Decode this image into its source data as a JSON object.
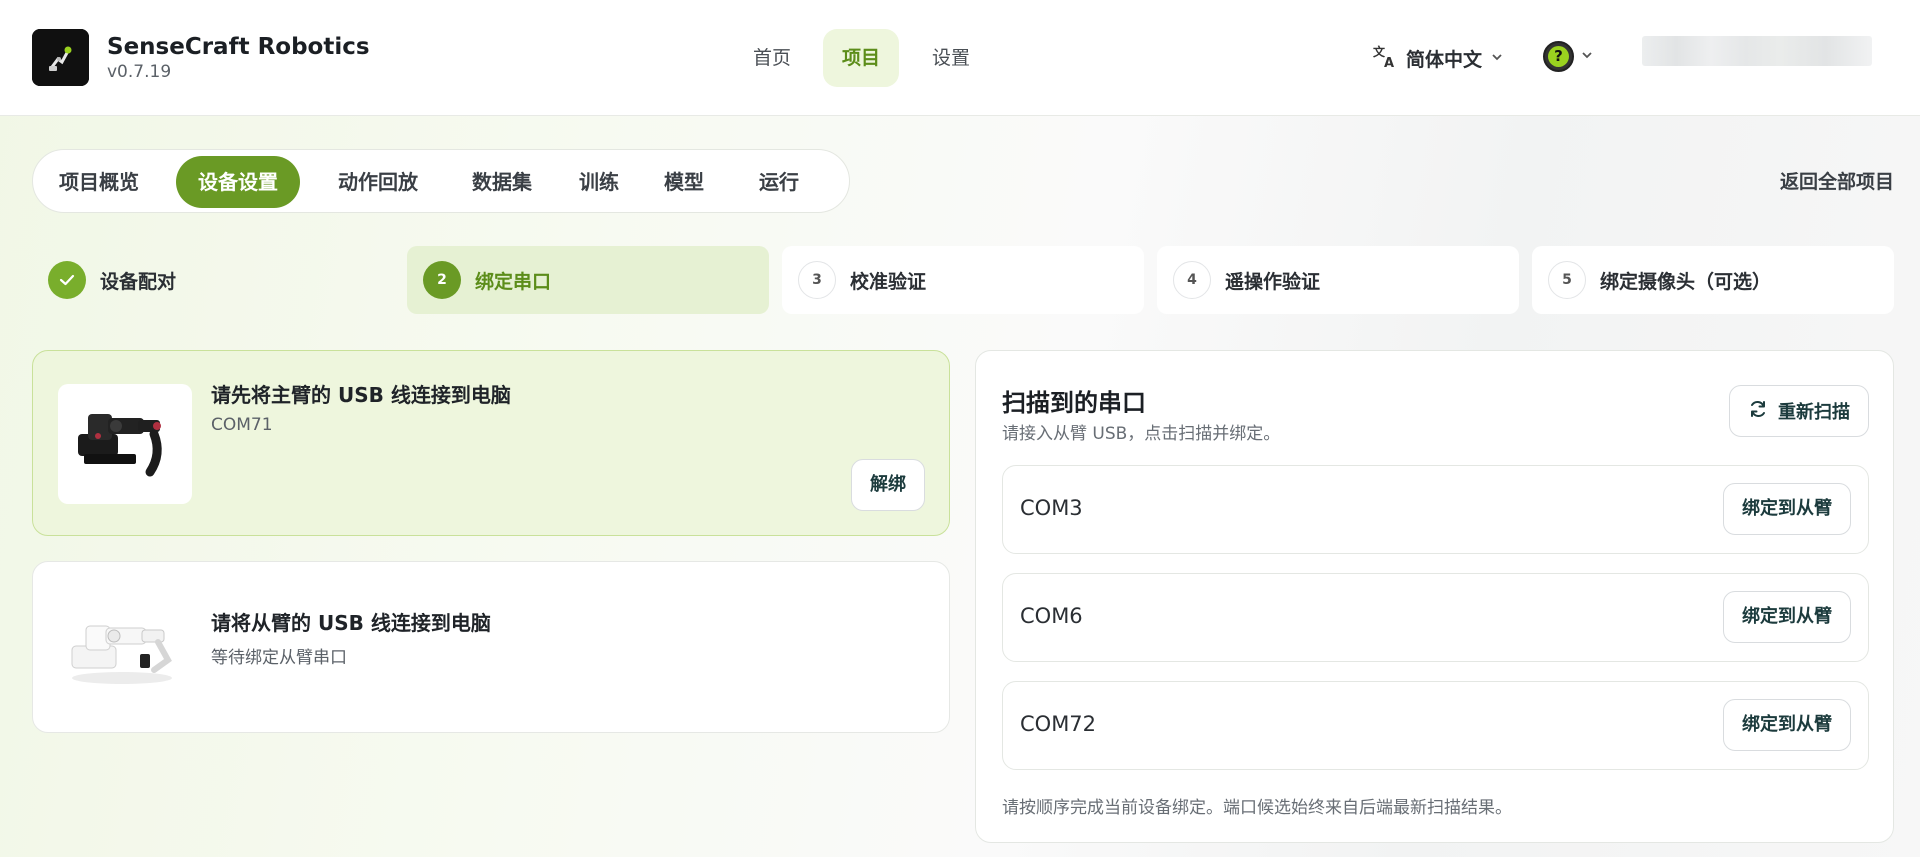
{
  "app": {
    "name": "SenseCraft Robotics",
    "version": "v0.7.19"
  },
  "topnav": {
    "items": [
      {
        "label": "首页"
      },
      {
        "label": "项目"
      },
      {
        "label": "设置"
      }
    ],
    "active": "项目",
    "language": "简体中文",
    "help_icon": "question-icon"
  },
  "tabs": {
    "items": [
      {
        "label": "项目概览"
      },
      {
        "label": "设备设置"
      },
      {
        "label": "动作回放"
      },
      {
        "label": "数据集"
      },
      {
        "label": "训练"
      },
      {
        "label": "模型"
      },
      {
        "label": "运行"
      }
    ],
    "active": "设备设置",
    "back_label": "返回全部项目"
  },
  "steps": [
    {
      "num": "1",
      "label": "设备配对",
      "state": "done"
    },
    {
      "num": "2",
      "label": "绑定串口",
      "state": "current"
    },
    {
      "num": "3",
      "label": "校准验证",
      "state": "todo"
    },
    {
      "num": "4",
      "label": "遥操作验证",
      "state": "todo"
    },
    {
      "num": "5",
      "label": "绑定摄像头（可选）",
      "state": "todo"
    }
  ],
  "devices": {
    "master": {
      "title": "请先将主臂的 USB 线连接到电脑",
      "subtitle": "COM71",
      "unbind_label": "解绑"
    },
    "slave": {
      "title": "请将从臂的 USB 线连接到电脑",
      "subtitle": "等待绑定从臂串口"
    }
  },
  "ports_panel": {
    "title": "扫描到的串口",
    "subtitle": "请接入从臂 USB，点击扫描并绑定。",
    "rescan_label": "重新扫描",
    "ports": [
      {
        "name": "COM3",
        "action": "绑定到从臂"
      },
      {
        "name": "COM6",
        "action": "绑定到从臂"
      },
      {
        "name": "COM72",
        "action": "绑定到从臂"
      }
    ],
    "note": "请按顺序完成当前设备绑定。端口候选始终来自后端最新扫描结果。"
  },
  "colors": {
    "accent": "#6a9a25",
    "accent_light": "#eef6dd",
    "accent_text": "#5c8d1a"
  }
}
